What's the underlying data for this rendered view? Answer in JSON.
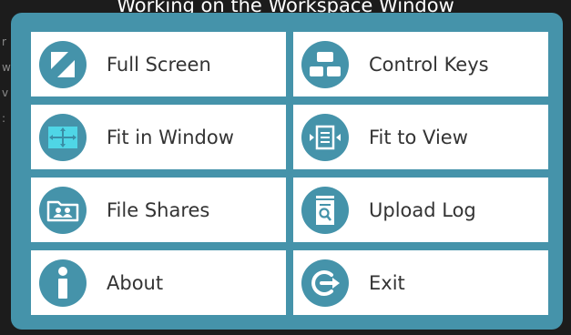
{
  "background": {
    "partial_text": "Working on the Workspace Window"
  },
  "colors": {
    "panel": "#4593aa",
    "tile": "#ffffff",
    "label": "#333333",
    "fit_in_window_accent": "#4fd6e6"
  },
  "menu": {
    "items": [
      {
        "label": "Full Screen",
        "icon": "full-screen-icon"
      },
      {
        "label": "Control Keys",
        "icon": "control-keys-icon"
      },
      {
        "label": "Fit in Window",
        "icon": "fit-in-window-icon"
      },
      {
        "label": "Fit to View",
        "icon": "fit-to-view-icon"
      },
      {
        "label": "File Shares",
        "icon": "file-shares-icon"
      },
      {
        "label": "Upload Log",
        "icon": "upload-log-icon"
      },
      {
        "label": "About",
        "icon": "info-icon"
      },
      {
        "label": "Exit",
        "icon": "exit-icon"
      }
    ]
  }
}
